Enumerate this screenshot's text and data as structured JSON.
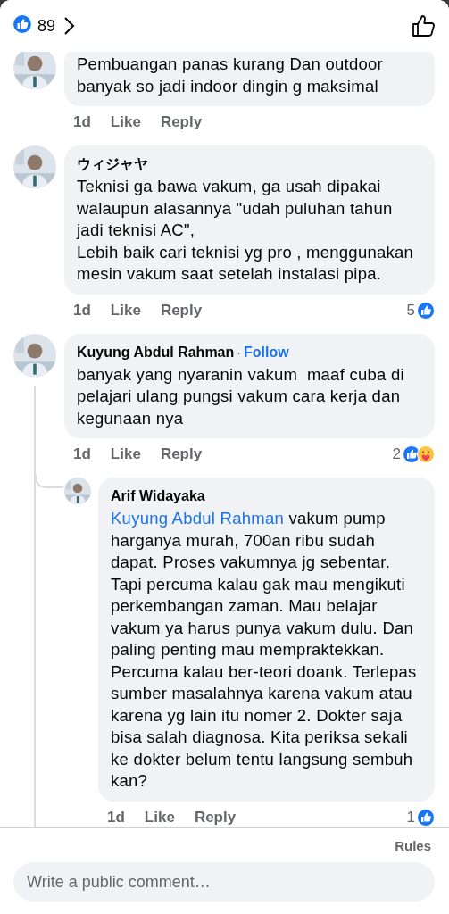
{
  "header": {
    "reaction_count": "89",
    "reactions": [
      {
        "kind": "like"
      }
    ]
  },
  "comments": [
    {
      "text": "Pembuangan panas kurang Dan outdoor banyak so jadi indoor dingin g maksimal",
      "time": "1d",
      "like": "Like",
      "reply": "Reply"
    },
    {
      "name": "ウィジャヤ",
      "text": "Teknisi ga bawa vakum, ga usah dipakai walaupun alasannya \"udah puluhan tahun jadi teknisi AC\",\nLebih baik cari teknisi yg pro , menggunakan mesin vakum saat setelah instalasi pipa.",
      "time": "1d",
      "like": "Like",
      "reply": "Reply",
      "reaction_count": "5",
      "reactions": [
        {
          "kind": "like"
        }
      ]
    },
    {
      "name": "Kuyung Abdul Rahman",
      "separator": "·",
      "follow": "Follow",
      "text": "banyak yang nyaranin vakum  maaf cuba di pelajari ulang pungsi vakum cara kerja dan kegunaan nya",
      "time": "1d",
      "like": "Like",
      "reply": "Reply",
      "reaction_count": "2",
      "reactions": [
        {
          "kind": "like"
        },
        {
          "kind": "care"
        }
      ],
      "children": [
        {
          "name": "Arif Widayaka",
          "mention": "Kuyung Abdul Rahman",
          "text": "vakum pump harganya murah, 700an ribu sudah dapat. Proses vakumnya jg sebentar. Tapi percuma kalau gak mau mengikuti perkembangan zaman. Mau belajar vakum ya harus punya vakum dulu. Dan paling penting mau mempraktekkan. Percuma kalau ber-teori doank. Terlepas sumber masalahnya karena vakum atau karena yg lain itu nomer 2. Dokter saja bisa salah diagnosa. Kita periksa sekali ke dokter belum tentu langsung sembuh kan?",
          "time": "1d",
          "like": "Like",
          "reply": "Reply",
          "reaction_count": "1",
          "reactions": [
            {
              "kind": "like"
            }
          ]
        }
      ]
    }
  ],
  "footer": {
    "rules": "Rules",
    "placeholder": "Write a public comment…"
  }
}
